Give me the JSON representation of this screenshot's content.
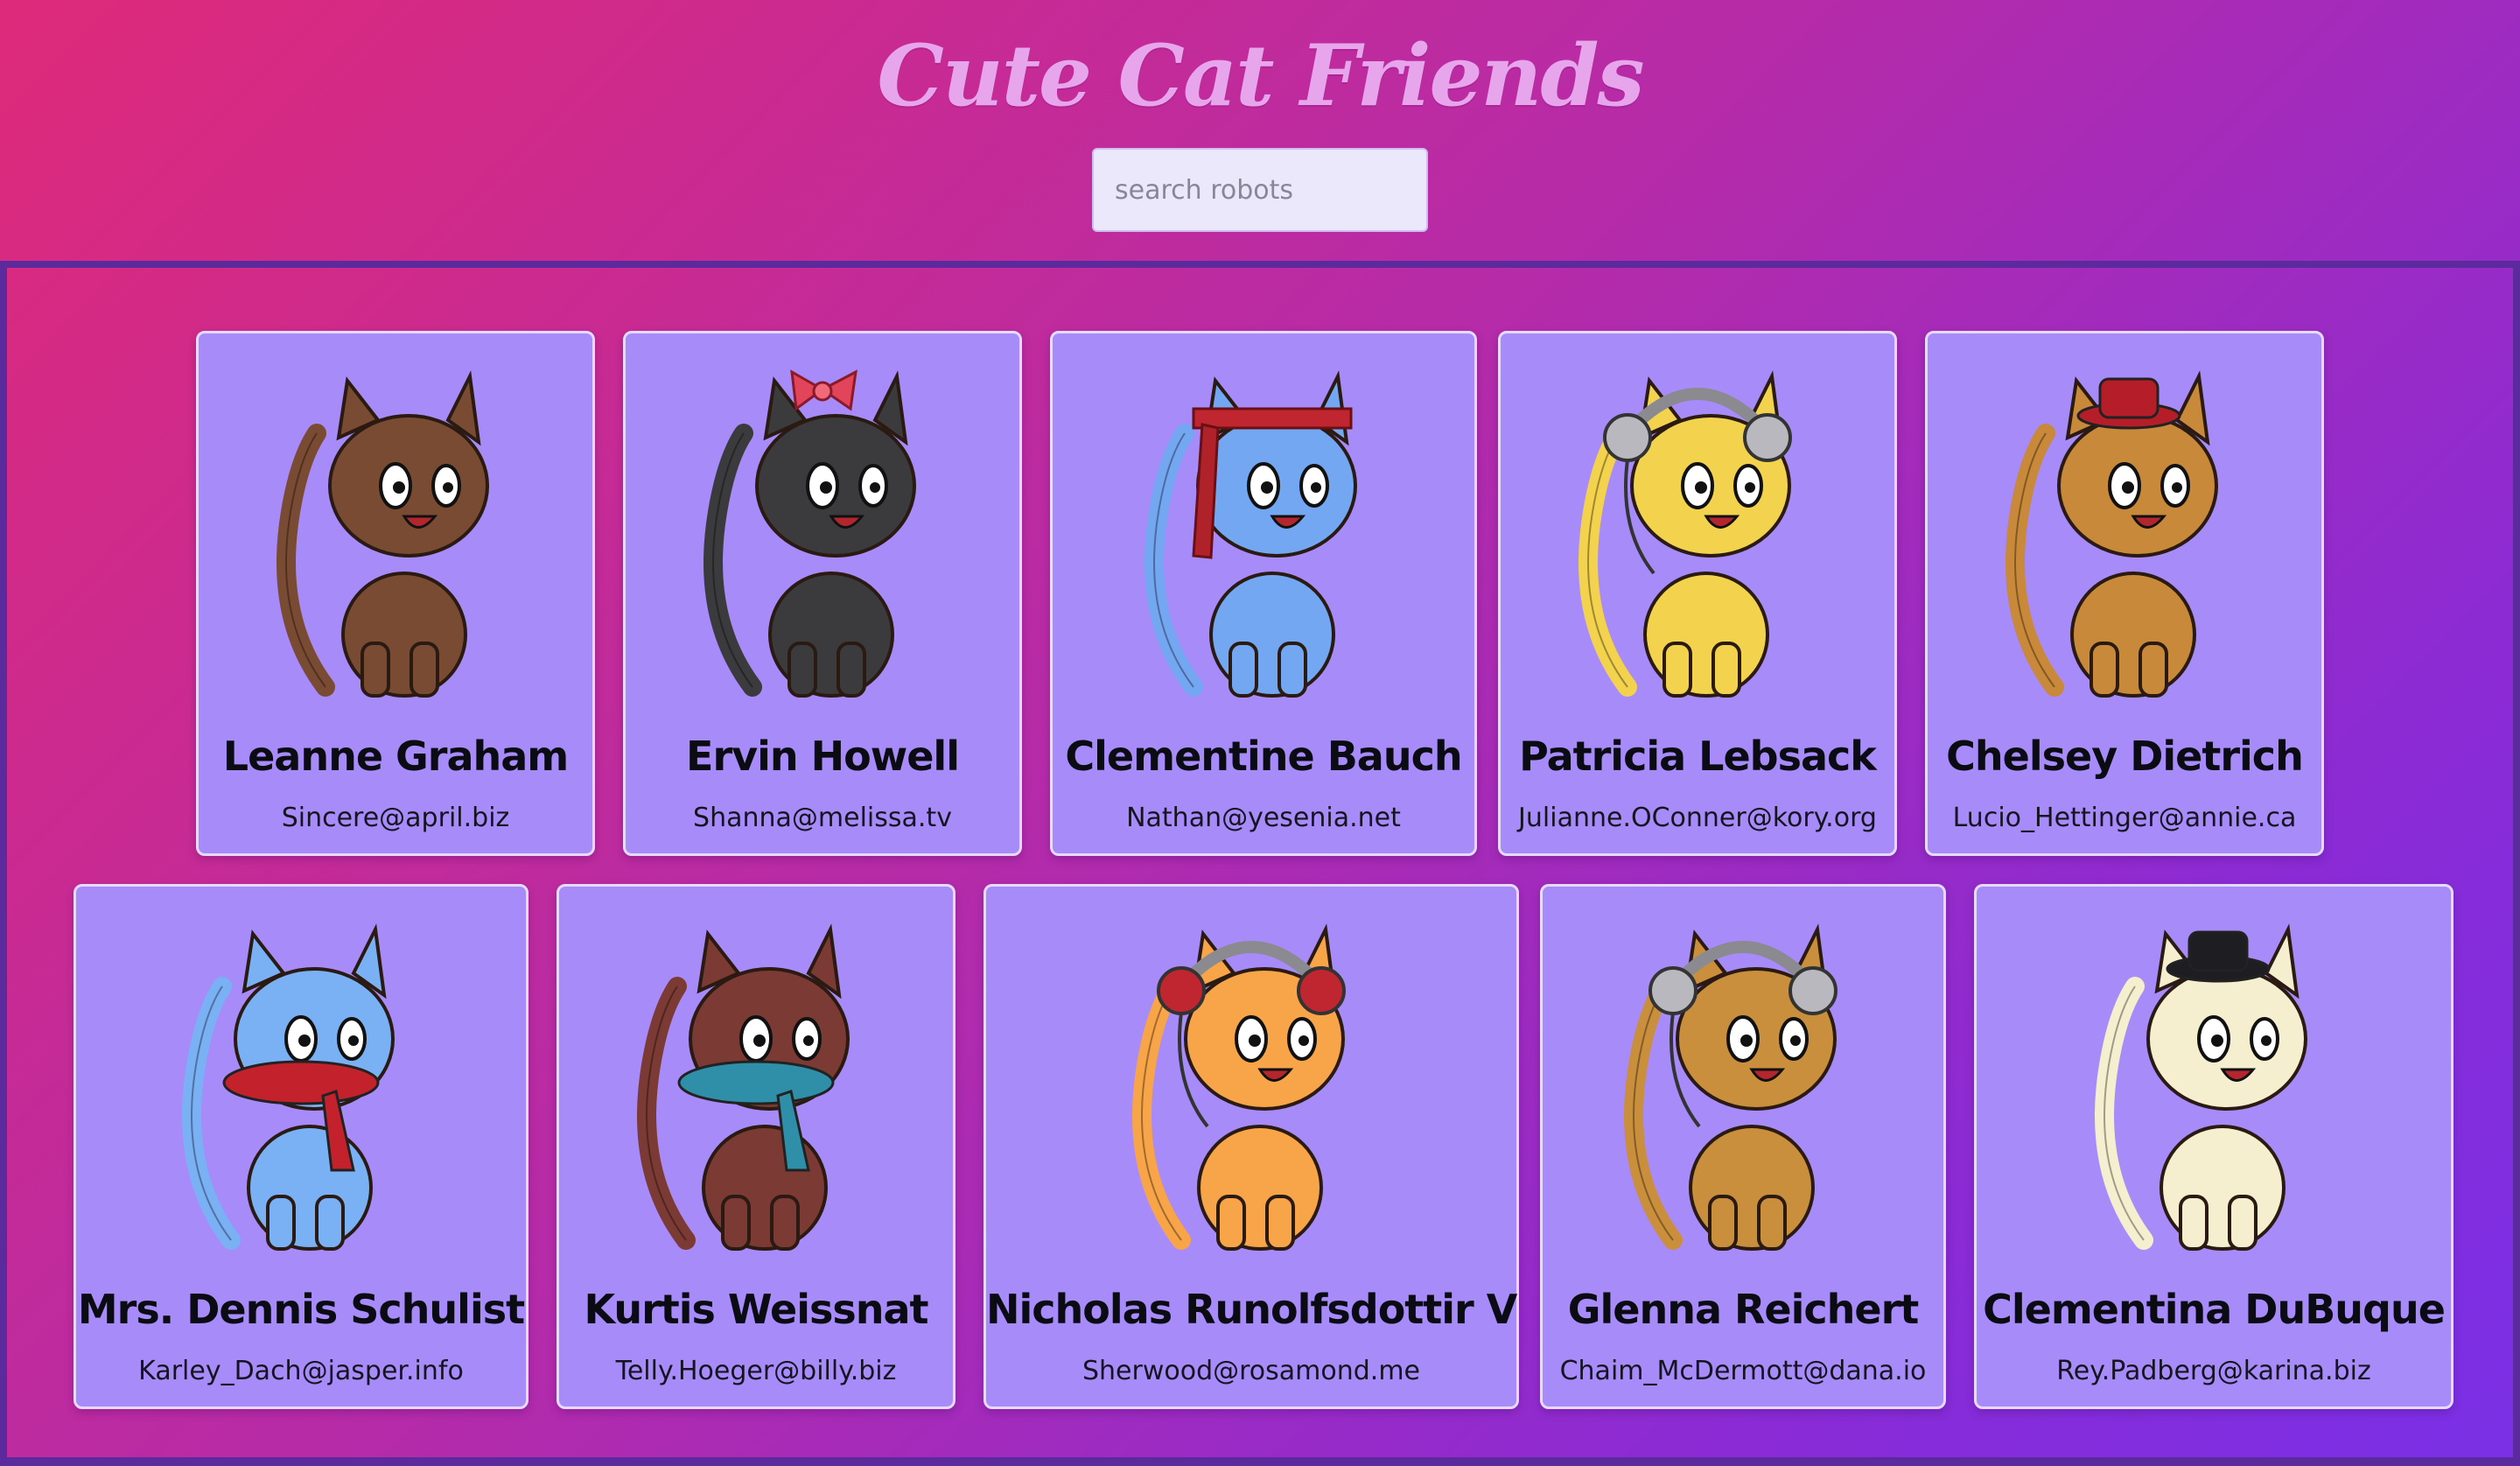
{
  "header": {
    "title": "Cute Cat Friends",
    "search_placeholder": "search robots"
  },
  "cards": [
    {
      "name": "Leanne Graham",
      "email": "Sincere@april.biz",
      "fur": "#7a4b33",
      "accessory": "none"
    },
    {
      "name": "Ervin Howell",
      "email": "Shanna@melissa.tv",
      "fur": "#3b3b3e",
      "accessory": "pink-bow"
    },
    {
      "name": "Clementine Bauch",
      "email": "Nathan@yesenia.net",
      "fur": "#74a7f2",
      "accessory": "red-headband"
    },
    {
      "name": "Patricia Lebsack",
      "email": "Julianne.OConner@kory.org",
      "fur": "#f3d24e",
      "accessory": "grey-headphones"
    },
    {
      "name": "Chelsey Dietrich",
      "email": "Lucio_Hettinger@annie.ca",
      "fur": "#c8893a",
      "accessory": "red-hat"
    },
    {
      "name": "Mrs. Dennis Schulist",
      "email": "Karley_Dach@jasper.info",
      "fur": "#7ab0f4",
      "accessory": "red-scarf"
    },
    {
      "name": "Kurtis Weissnat",
      "email": "Telly.Hoeger@billy.biz",
      "fur": "#7b3a33",
      "accessory": "blue-scarf"
    },
    {
      "name": "Nicholas Runolfsdottir V",
      "email": "Sherwood@rosamond.me",
      "fur": "#f7a548",
      "accessory": "red-headphones"
    },
    {
      "name": "Glenna Reichert",
      "email": "Chaim_McDermott@dana.io",
      "fur": "#c98f3c",
      "accessory": "grey-headphones"
    },
    {
      "name": "Clementina DuBuque",
      "email": "Rey.Padberg@karina.biz",
      "fur": "#f5efcf",
      "accessory": "black-hat"
    }
  ]
}
